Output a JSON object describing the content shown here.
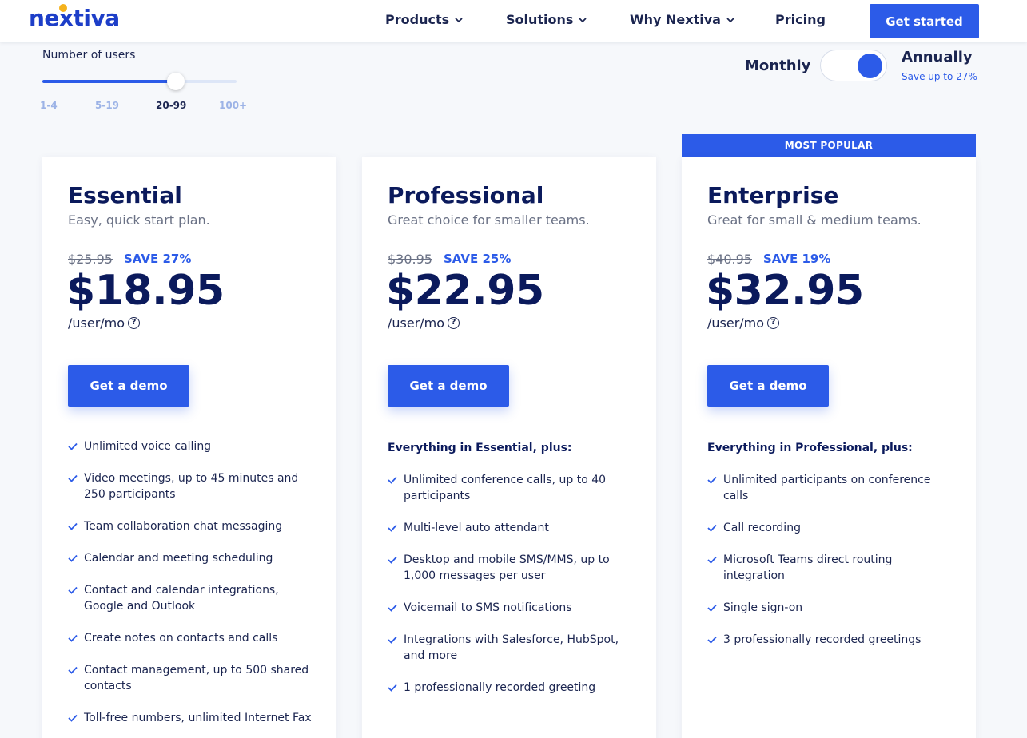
{
  "header": {
    "logo": "nextiva",
    "nav": [
      {
        "label": "Products",
        "has_menu": true
      },
      {
        "label": "Solutions",
        "has_menu": true
      },
      {
        "label": "Why Nextiva",
        "has_menu": true
      },
      {
        "label": "Pricing",
        "has_menu": false
      }
    ],
    "cta": "Get started"
  },
  "users": {
    "label": "Number of users",
    "ticks": [
      "1-4",
      "5-19",
      "20-99",
      "100+"
    ],
    "selected": "20-99",
    "slider_fraction": 0.68
  },
  "billing": {
    "monthly": "Monthly",
    "annually": "Annually",
    "save_note": "Save up to 27%",
    "selected": "Annually"
  },
  "colors": {
    "accent": "#2c5be8",
    "navy": "#0b1a5c",
    "logo_dot": "#f5b21c"
  },
  "plans": [
    {
      "name": "Essential",
      "desc": "Easy, quick start plan.",
      "old_price": "$25.95",
      "save": "SAVE 27%",
      "price": "$18.95",
      "per": "/user/mo",
      "cta": "Get a demo",
      "plus_label": "",
      "features": [
        "Unlimited voice calling",
        "Video meetings, up to 45 minutes and 250 participants",
        "Team collaboration chat messaging",
        "Calendar and meeting scheduling",
        "Contact and calendar integrations, Google and Outlook",
        "Create notes on contacts and calls",
        "Contact management, up to 500 shared contacts",
        "Toll-free numbers, unlimited Internet Fax"
      ]
    },
    {
      "name": "Professional",
      "desc": "Great choice for smaller teams.",
      "old_price": "$30.95",
      "save": "SAVE 25%",
      "price": "$22.95",
      "per": "/user/mo",
      "cta": "Get a demo",
      "plus_label": "Everything in Essential, plus:",
      "features": [
        "Unlimited conference calls, up to 40 participants",
        "Multi-level auto attendant",
        "Desktop and mobile SMS/MMS, up to 1,000 messages per user",
        "Voicemail to SMS notifications",
        "Integrations with Salesforce, HubSpot, and more",
        "1 professionally recorded greeting"
      ]
    },
    {
      "name": "Enterprise",
      "badge": "MOST POPULAR",
      "desc": "Great for small & medium teams.",
      "old_price": "$40.95",
      "save": "SAVE 19%",
      "price": "$32.95",
      "per": "/user/mo",
      "cta": "Get a demo",
      "plus_label": "Everything in Professional, plus:",
      "features": [
        "Unlimited participants on conference calls",
        "Call recording",
        "Microsoft Teams direct routing integration",
        "Single sign-on",
        "3 professionally recorded greetings"
      ]
    }
  ]
}
